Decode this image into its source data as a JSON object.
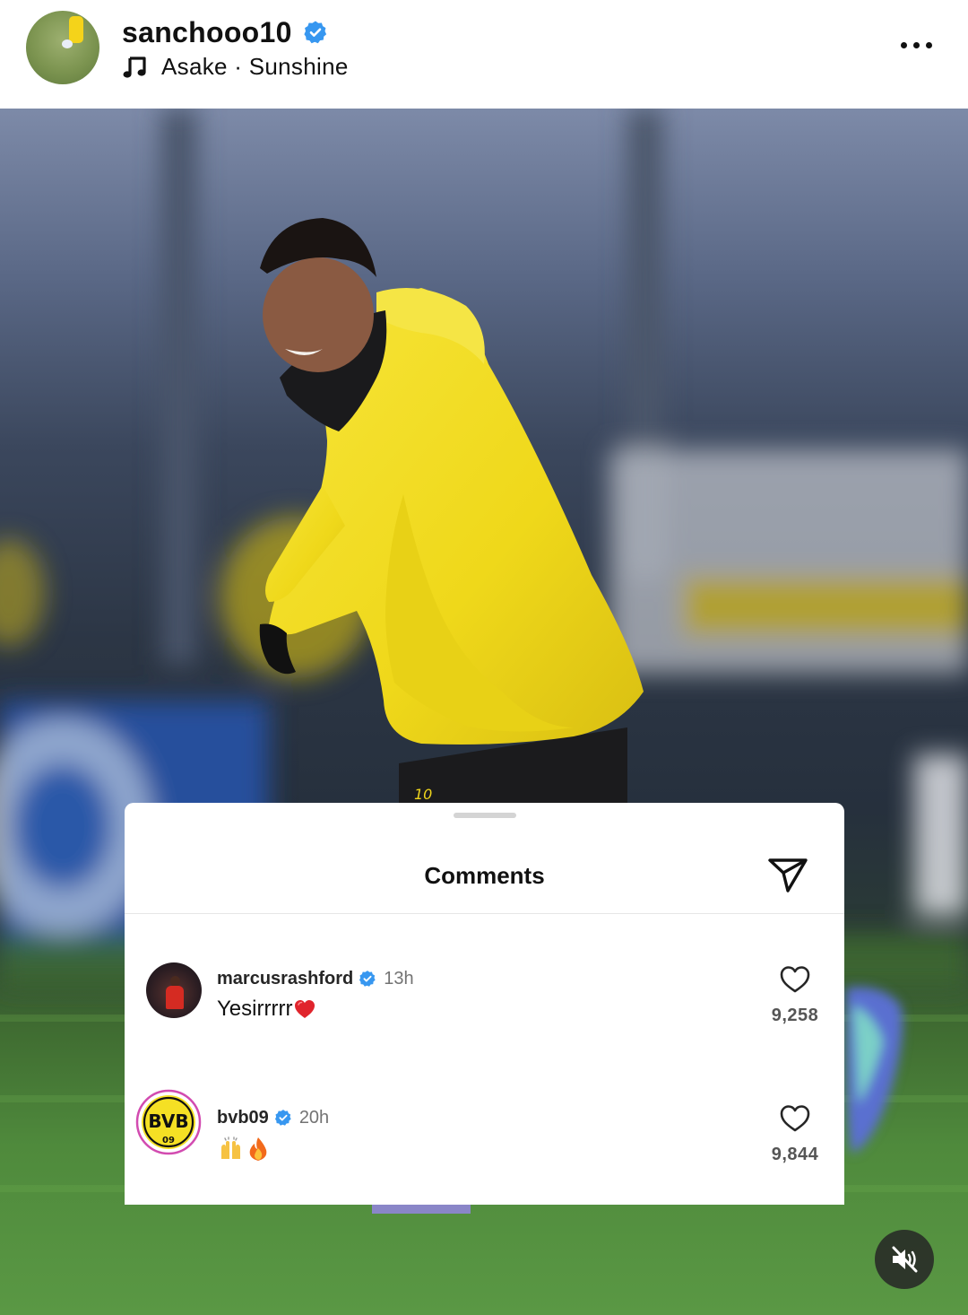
{
  "post": {
    "username": "sanchooo10",
    "verified_icon": "verified-badge-icon",
    "music_icon": "music-note-icon",
    "audio": "Asake · Sunshine",
    "more_icon": "more-options-icon",
    "media": {
      "subject": "player in yellow training jacket",
      "jersey_number": "10"
    }
  },
  "comments_sheet": {
    "title": "Comments",
    "share_icon": "share-send-icon",
    "items": [
      {
        "username": "marcusrashford",
        "verified": true,
        "time": "13h",
        "text": "Yesirrrrr",
        "emoji": [
          "red-heart"
        ],
        "likes": "9,258"
      },
      {
        "username": "bvb09",
        "verified": true,
        "time": "20h",
        "text": "",
        "emoji": [
          "raising-hands",
          "fire"
        ],
        "likes": "9,844"
      }
    ],
    "bvb_logo": {
      "line1": "BVB",
      "line2": "09"
    }
  },
  "controls": {
    "mute_icon": "speaker-muted-icon"
  },
  "colors": {
    "accent_blue": "#3797f0",
    "jacket_yellow": "#f3df1e",
    "heart_red": "#e0242c"
  }
}
